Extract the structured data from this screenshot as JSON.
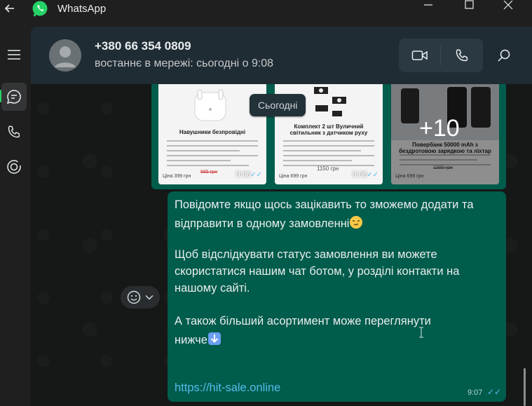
{
  "window": {
    "app_title": "WhatsApp"
  },
  "header": {
    "contact_name": "+380 66 354 0809",
    "status": "востаннє в мережі: сьогодні о 9:08"
  },
  "date_divider": "Сьогодні",
  "media": [
    {
      "title": "Навушники безпровідні",
      "old_price": "665 грн",
      "price": "Ціна 399 грн",
      "time": "9:06"
    },
    {
      "title": "Комплект 2 шт Вуличний світильник з датчиком руху",
      "old_price": "1150 грн",
      "price": "Ціна 699 грн",
      "time": "9:06"
    },
    {
      "title": "Повербанк 50000 mAh з бездротовою зарядкою та ліхтар",
      "old_price": "1200 грн",
      "price": "Ціна 699 грн",
      "more_count": "+10"
    }
  ],
  "message": {
    "lines": [
      "Повідомте якщо щось зацікавить то зможемо додати та",
      "відправити в одному замовленні",
      "Щоб відслідкувати статус замовлення ви можете",
      "скористатися нашим чат ботом, у розділі контакти на",
      "нашому сайті.",
      "А також більший асортимент може переглянути",
      "нижче"
    ],
    "link": "https://hit-sale.online",
    "time": "9:07"
  },
  "colors": {
    "outgoing_bubble": "#005c4b",
    "header_bg": "#202c33",
    "link": "#53bdeb",
    "accent": "#25d366"
  },
  "icons": [
    "back-arrow-icon",
    "whatsapp-logo-icon",
    "minimize-icon",
    "maximize-icon",
    "close-icon",
    "menu-icon",
    "chats-icon",
    "calls-icon",
    "status-icon",
    "video-call-icon",
    "voice-call-icon",
    "search-icon",
    "emoji-icon",
    "chevron-down-icon",
    "double-check-icon"
  ]
}
